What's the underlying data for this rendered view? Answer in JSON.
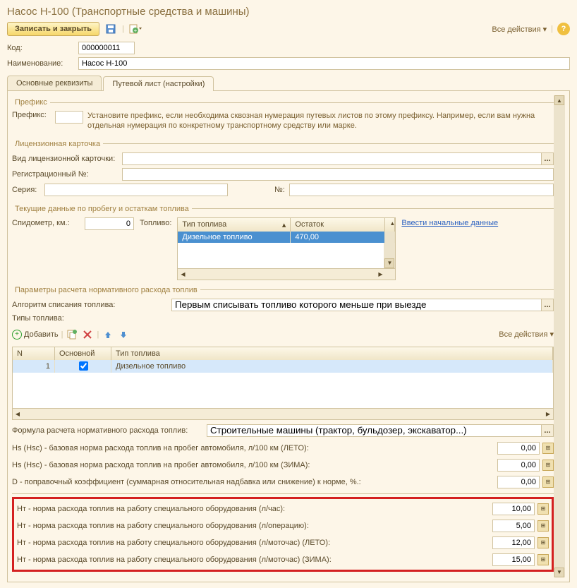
{
  "title": "Насос Н-100 (Транспортные средства и машины)",
  "toolbar": {
    "save_close": "Записать и закрыть",
    "all_actions": "Все действия"
  },
  "header": {
    "code_label": "Код:",
    "code_value": "000000011",
    "name_label": "Наименование:",
    "name_value": "Насос Н-100"
  },
  "tabs": {
    "main": "Основные реквизиты",
    "route": "Путевой лист (настройки)"
  },
  "prefix": {
    "legend": "Префикс",
    "label": "Префикс:",
    "hint": "Установите префикс, если необходима сквозная нумерация путевых листов по этому префиксу. Например, если вам нужна отдельная нумерация по конкретному  транспортному средству  или марке."
  },
  "license": {
    "legend": "Лицензионная карточка",
    "type_label": "Вид лицензионной карточки:",
    "reg_label": "Регистрационный №:",
    "series_label": "Серия:",
    "num_label": "№:"
  },
  "mileage": {
    "legend": "Текущие данные по пробегу и остаткам топлива",
    "odo_label": "Спидометр, км.:",
    "odo_value": "0",
    "fuel_label": "Топливо:",
    "col_type": "Тип топлива",
    "col_rest": "Остаток",
    "row_type": "Дизельное топливо",
    "row_rest": "470,00",
    "link": "Ввести начальные данные"
  },
  "params": {
    "legend": "Параметры расчета нормативного расхода топлив",
    "algo_label": "Алгоритм списания топлива:",
    "algo_value": "Первым списывать топливо которого меньше при выезде",
    "types_label": "Типы топлива:",
    "add": "Добавить",
    "all_actions": "Все действия",
    "col_n": "N",
    "col_main": "Основной",
    "col_type": "Тип топлива",
    "row_n": "1",
    "row_type": "Дизельное топливо",
    "formula_label": "Формула расчета нормативного расхода топлив:",
    "formula_value": "Строительные машины (трактор, бульдозер, экскаватор...)"
  },
  "coeffs": {
    "hs_summer": "Hs (Hsc) -  базовая норма расхода топлив на пробег автомобиля, л/100 км (ЛЕТО):",
    "hs_winter": "Hs (Hsc) -  базовая норма расхода топлив на пробег автомобиля, л/100 км (ЗИМА):",
    "d_corr": "D - поправочный коэффициент (суммарная относительная надбавка или снижение) к норме, %.:",
    "v_hs_summer": "0,00",
    "v_hs_winter": "0,00",
    "v_d": "0,00",
    "nt_hour": "Нт - норма расхода топлив на работу специального оборудования (л/час):",
    "nt_oper": "Нт - норма расхода топлив на работу специального оборудования (л/операцию):",
    "nt_mh_s": "Нт - норма расхода топлив на работу специального оборудования (л/моточас) (ЛЕТО):",
    "nt_mh_w": "Нт - норма расхода топлив на работу специального оборудования (л/моточас) (ЗИМА):",
    "v_nt_hour": "10,00",
    "v_nt_oper": "5,00",
    "v_nt_mh_s": "12,00",
    "v_nt_mh_w": "15,00"
  }
}
